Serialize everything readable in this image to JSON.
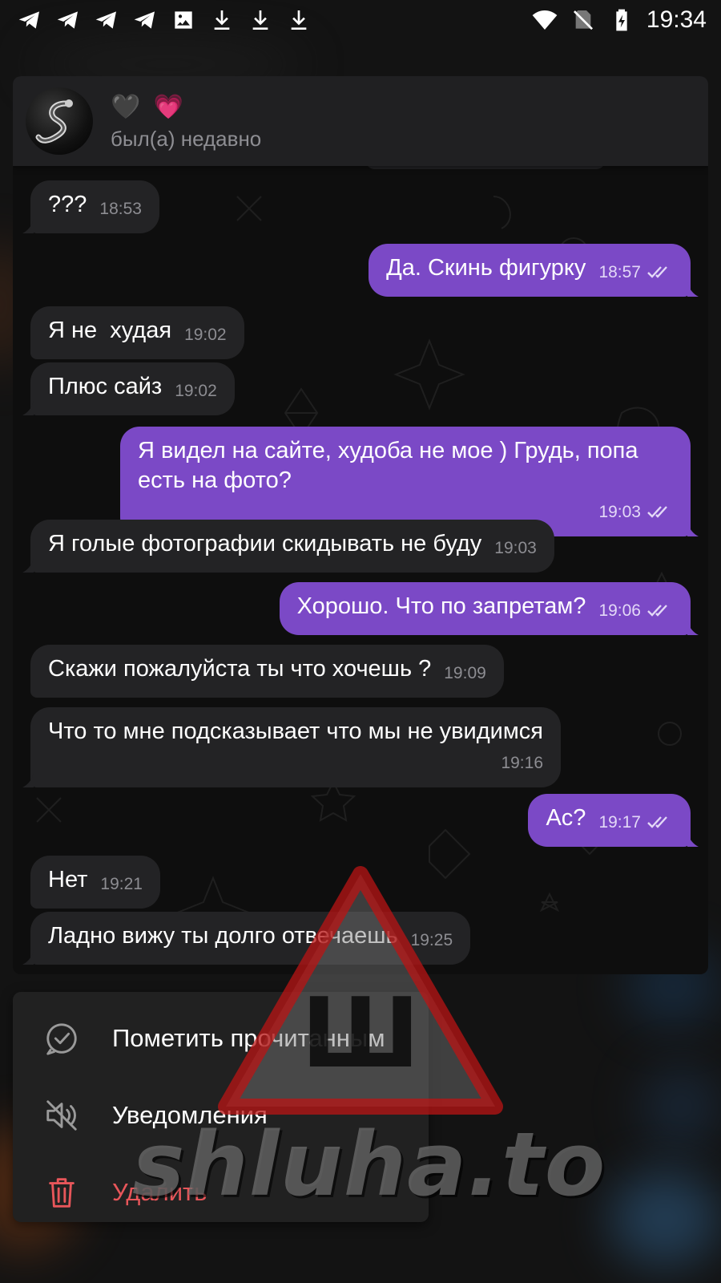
{
  "status_bar": {
    "time": "19:34",
    "left_icons": [
      "telegram-icon",
      "telegram-icon",
      "telegram-icon",
      "telegram-icon",
      "image-icon",
      "download-icon",
      "download-icon",
      "download-icon"
    ],
    "right_icons": [
      "wifi-icon",
      "no-sim-icon",
      "battery-charging-icon"
    ]
  },
  "chat": {
    "contact_name": "🖤 💗",
    "contact_status": "был(а) недавно",
    "messages": [
      {
        "dir": "in",
        "text": "???",
        "time": "18:53"
      },
      {
        "dir": "out",
        "text": "Да. Скинь фигурку",
        "time": "18:57",
        "read": true
      },
      {
        "dir": "in",
        "text": "Я не  худая",
        "time": "19:02"
      },
      {
        "dir": "in",
        "text": "Плюс сайз",
        "time": "19:02"
      },
      {
        "dir": "out",
        "text": "Я видел на сайте, худоба не мое ) Грудь, попа есть на фото?",
        "time": "19:03",
        "read": true
      },
      {
        "dir": "in",
        "text": "Я голые фотографии скидывать не буду",
        "time": "19:03"
      },
      {
        "dir": "out",
        "text": "Хорошо. Что по запретам?",
        "time": "19:06",
        "read": true
      },
      {
        "dir": "in",
        "text": "Скажи пожалуйста ты что хочешь ?",
        "time": "19:09"
      },
      {
        "dir": "in",
        "text": "Что то мне подсказывает что мы не увидимся",
        "time": "19:16"
      },
      {
        "dir": "out",
        "text": "Ас?",
        "time": "19:17",
        "read": true
      },
      {
        "dir": "in",
        "text": "Нет",
        "time": "19:21"
      },
      {
        "dir": "in",
        "text": "Ладно вижу ты долго отвечаешь",
        "time": "19:25"
      }
    ]
  },
  "context_menu": {
    "items": [
      {
        "label": "Пометить прочитанным",
        "icon": "check-circle-icon"
      },
      {
        "label": "Уведомления",
        "icon": "mute-icon"
      },
      {
        "label": "Удалить",
        "icon": "trash-icon",
        "danger_color": "#e8565a"
      }
    ]
  },
  "watermark": {
    "text": "shluha.to",
    "sign_letter": "Ш"
  },
  "colors": {
    "outgoing_bubble": "#7b49c6",
    "incoming_bubble": "#232325",
    "header": "#202022",
    "menu": "#212121"
  }
}
